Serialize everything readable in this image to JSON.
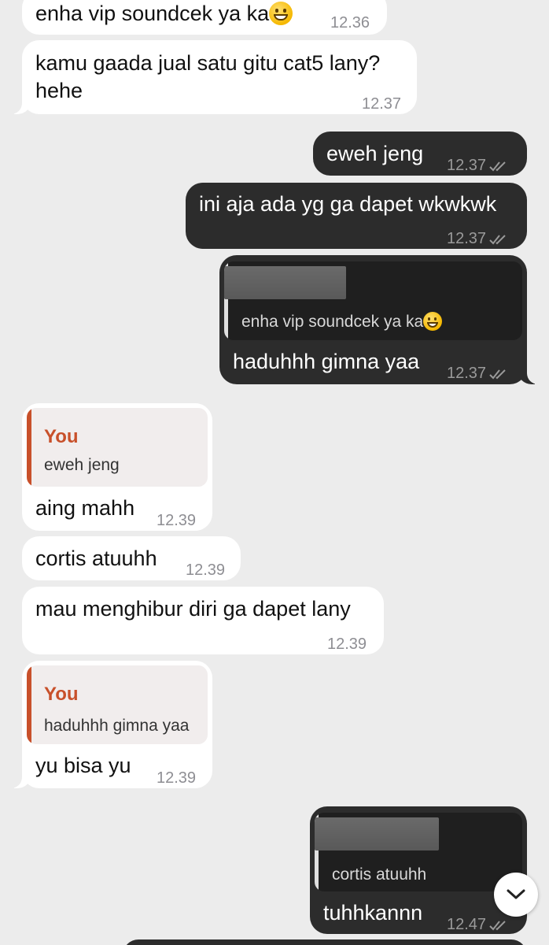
{
  "messages": {
    "m1": {
      "text": "enha vip soundcek ya ka",
      "time": "12.36"
    },
    "m2": {
      "line1": "kamu gaada jual satu gitu cat5 lany?",
      "line2": "hehe",
      "time": "12.37"
    },
    "m3": {
      "text": "eweh jeng",
      "time": "12.37"
    },
    "m4": {
      "text": "ini aja ada yg ga dapet wkwkwk",
      "time": "12.37"
    },
    "m5": {
      "quote_text": "enha vip soundcek ya ka",
      "text": "haduhhh gimna yaa",
      "time": "12.37"
    },
    "m6": {
      "quote_name": "You",
      "quote_text": "eweh jeng",
      "text": "aing mahh",
      "time": "12.39"
    },
    "m7": {
      "text": "cortis atuuhh",
      "time": "12.39"
    },
    "m8": {
      "text": "mau menghibur diri ga dapet lany",
      "time": "12.39"
    },
    "m9": {
      "quote_name": "You",
      "quote_text": "haduhhh gimna yaa",
      "text": "yu bisa yu",
      "time": "12.39"
    },
    "m10": {
      "quote_text": "cortis atuuhh",
      "text": "tuhhkannn",
      "time": "12.47"
    }
  },
  "icons": {
    "read_receipt": "double-check-icon",
    "emoji": "grinning-face-emoji",
    "scroll_down": "chevron-down-icon"
  },
  "colors": {
    "background": "#ececec",
    "incoming_bubble": "#ffffff",
    "outgoing_bubble": "#2c2c2c",
    "quote_accent": "#c8502a"
  }
}
